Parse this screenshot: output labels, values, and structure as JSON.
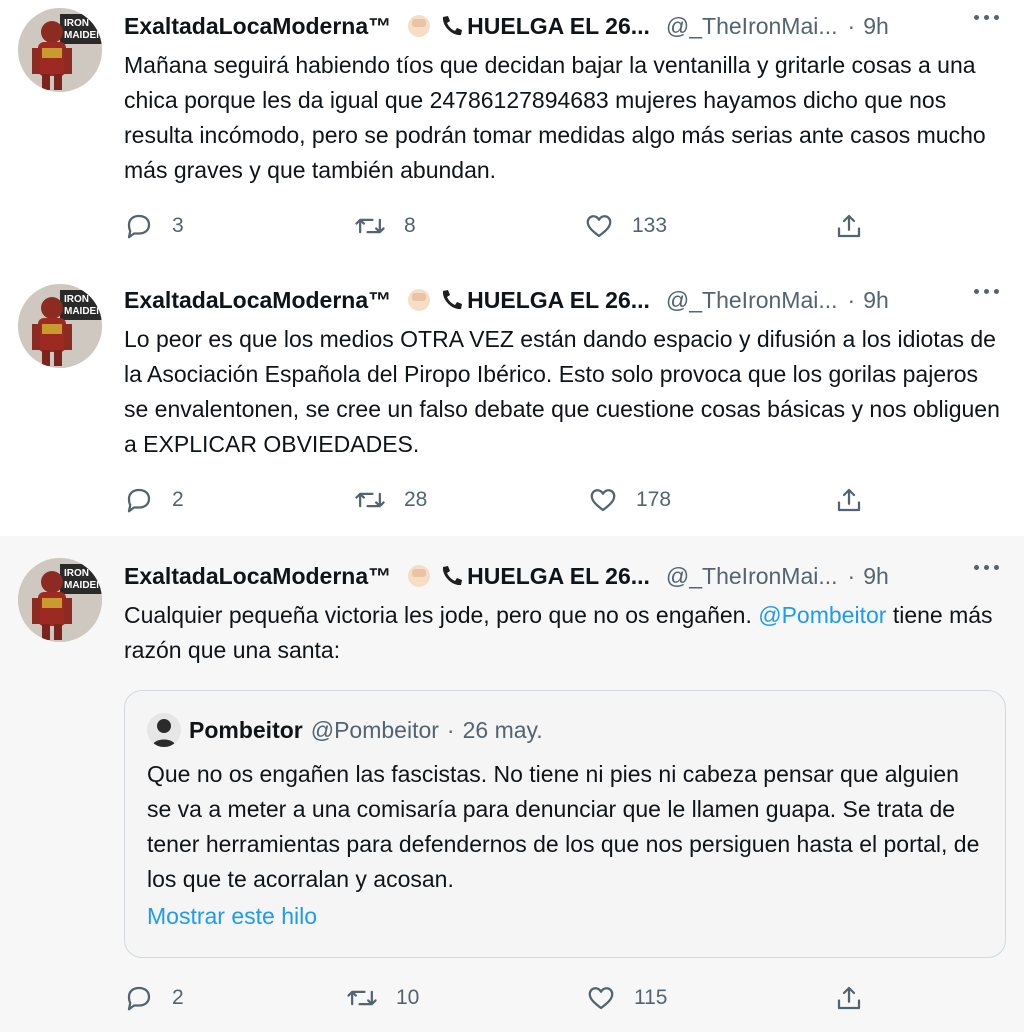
{
  "tweets": [
    {
      "display_name": "ExaltadaLocaModerna™",
      "display_tail": "HUELGA EL 26...",
      "handle": "@_TheIronMai...",
      "separator": "·",
      "time": "9h",
      "text": "Mañana seguirá habiendo tíos que decidan bajar la ventanilla y gritarle cosas a una chica porque les da igual que 24786127894683 mujeres hayamos dicho que nos resulta incómodo, pero se podrán tomar medidas algo más serias ante casos mucho más graves y que también abundan.",
      "replies": "3",
      "retweets": "8",
      "likes": "133"
    },
    {
      "display_name": "ExaltadaLocaModerna™",
      "display_tail": "HUELGA EL 26...",
      "handle": "@_TheIronMai...",
      "separator": "·",
      "time": "9h",
      "text": "Lo peor es que los medios OTRA VEZ están dando espacio y difusión a los idiotas de la Asociación Española del Piropo Ibérico. Esto solo provoca que los gorilas pajeros se envalentonen, se cree un falso debate que cuestione cosas básicas y nos obliguen a EXPLICAR OBVIEDADES.",
      "replies": "2",
      "retweets": "28",
      "likes": "178"
    },
    {
      "display_name": "ExaltadaLocaModerna™",
      "display_tail": "HUELGA EL 26...",
      "handle": "@_TheIronMai...",
      "separator": "·",
      "time": "9h",
      "text_before": "Cualquier pequeña victoria les jode, pero que no os engañen.",
      "mention": "@Pombeitor",
      "text_after": "tiene más razón que una santa:",
      "replies": "2",
      "retweets": "10",
      "likes": "115",
      "quote": {
        "name": "Pombeitor",
        "handle": "@Pombeitor",
        "separator": "·",
        "date": "26 may.",
        "text": "Que no os engañen las fascistas. No tiene ni pies ni cabeza pensar que alguien se va a meter a una comisaría para denunciar que le llamen guapa. Se trata de tener herramientas para defendernos de los que nos persiguen hasta el portal, de los que te acorralan y acosan.",
        "show_thread": "Mostrar este hilo"
      }
    }
  ],
  "icons": {
    "reply": "reply-icon",
    "retweet": "retweet-icon",
    "like": "heart-icon",
    "share": "share-icon",
    "more": "more-icon",
    "fist": "raised-fist-emoji",
    "phone": "telephone-emoji"
  },
  "colors": {
    "accent": "#1d9bf0",
    "muted": "#536471",
    "text": "#0f1419",
    "thread_line": "#cfd9de"
  }
}
